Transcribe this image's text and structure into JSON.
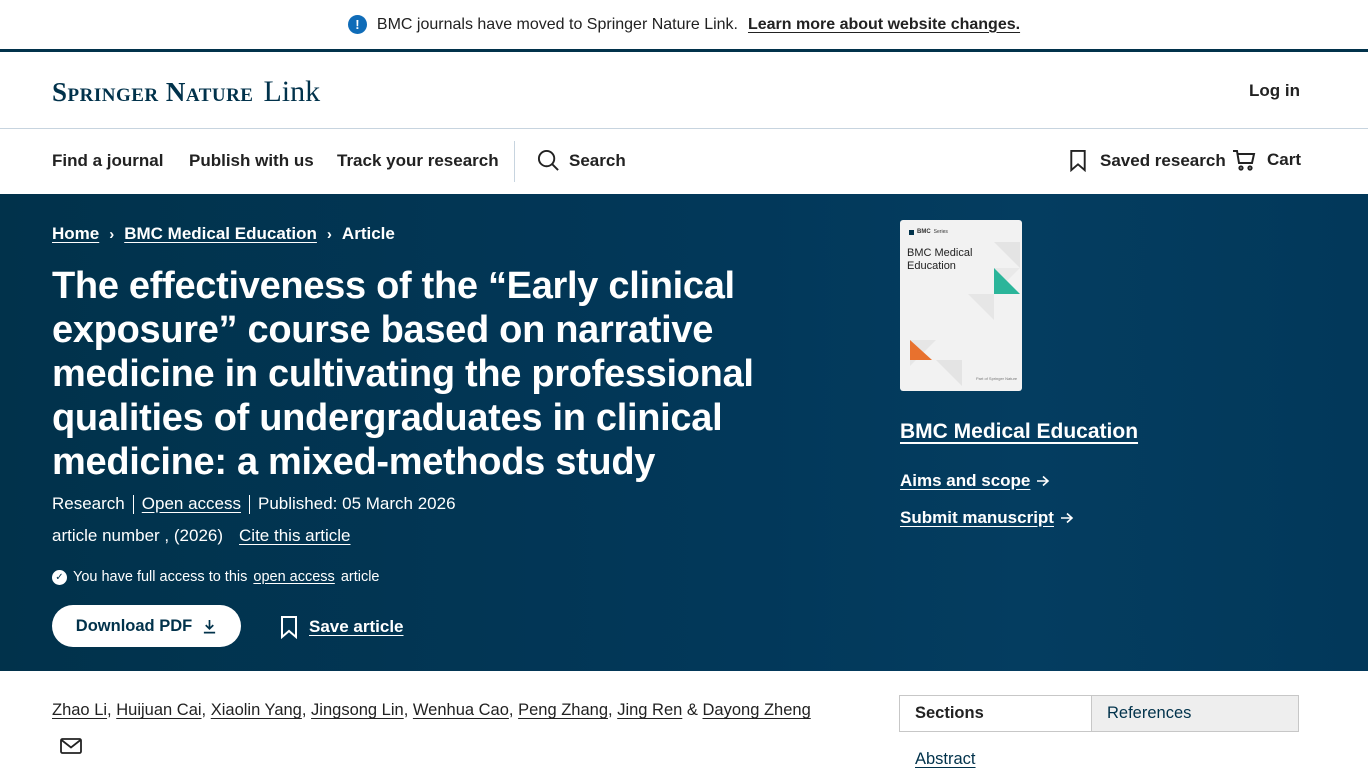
{
  "notice": {
    "text": "BMC journals have moved to Springer Nature Link.",
    "link": "Learn more about website changes.",
    "icon": "info-icon"
  },
  "header": {
    "logo_main": "Springer Nature",
    "logo_sub": "Link",
    "login": "Log in"
  },
  "nav": {
    "find_journal": "Find a journal",
    "publish": "Publish with us",
    "track": "Track your research",
    "search": "Search",
    "saved": "Saved research",
    "cart": "Cart"
  },
  "breadcrumb": {
    "home": "Home",
    "journal": "BMC Medical Education",
    "current": "Article",
    "separator": "›"
  },
  "article": {
    "title": "The effectiveness of the “Early clinical exposure” course based on narrative medicine in cultivating the professional qualities of undergraduates in clinical medicine: a mixed-methods study",
    "type": "Research",
    "access": "Open access",
    "published": "Published: 05 March 2026",
    "number": "article number , (2026)",
    "cite": "Cite this article",
    "access_prefix": "You have full access to this",
    "access_link": "open access",
    "access_suffix": "article",
    "download": "Download PDF",
    "save": "Save article"
  },
  "journal": {
    "cover_series": "BMC",
    "cover_series_sub": "Series",
    "cover_title": "BMC Medical Education",
    "cover_footer": "Part of Springer Nature",
    "name": "BMC Medical Education",
    "aims": "Aims and scope",
    "submit": "Submit manuscript",
    "accent_green": "#2bb59a",
    "accent_orange": "#e8712e"
  },
  "authors": {
    "list": [
      "Zhao Li",
      "Huijuan Cai",
      "Xiaolin Yang",
      "Jingsong Lin",
      "Wenhua Cao",
      "Peng Zhang",
      "Jing Ren"
    ],
    "last": "Dayong Zheng",
    "conjunction": "&",
    "comma": ","
  },
  "sections": {
    "tab_sections": "Sections",
    "tab_references": "References",
    "first": "Abstract"
  },
  "colors": {
    "brand_dark": "#01324b",
    "info_blue": "#0f6cb8"
  }
}
